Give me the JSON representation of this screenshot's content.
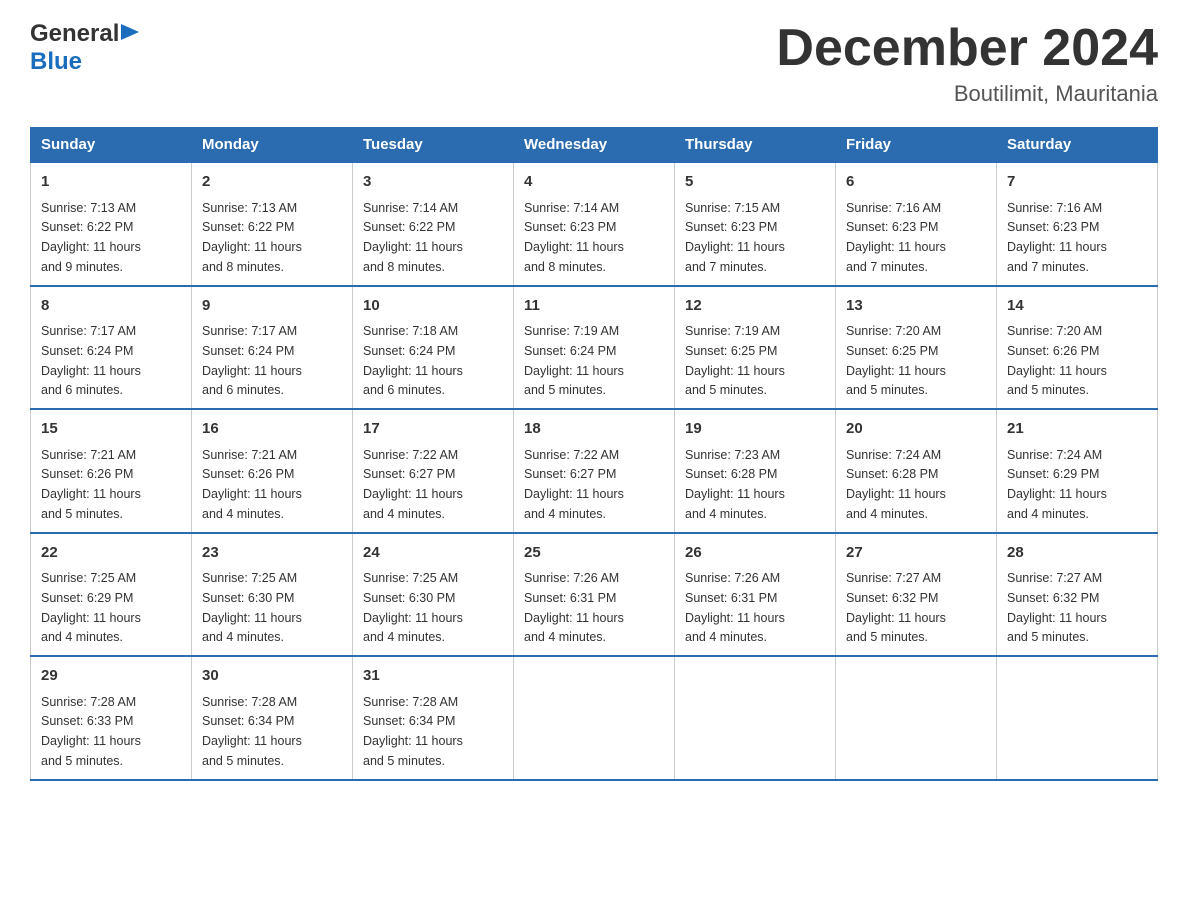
{
  "header": {
    "logo_general": "General",
    "logo_blue": "Blue",
    "month_title": "December 2024",
    "location": "Boutilimit, Mauritania"
  },
  "days_of_week": [
    "Sunday",
    "Monday",
    "Tuesday",
    "Wednesday",
    "Thursday",
    "Friday",
    "Saturday"
  ],
  "weeks": [
    [
      {
        "day": "1",
        "sunrise": "7:13 AM",
        "sunset": "6:22 PM",
        "daylight": "11 hours and 9 minutes."
      },
      {
        "day": "2",
        "sunrise": "7:13 AM",
        "sunset": "6:22 PM",
        "daylight": "11 hours and 8 minutes."
      },
      {
        "day": "3",
        "sunrise": "7:14 AM",
        "sunset": "6:22 PM",
        "daylight": "11 hours and 8 minutes."
      },
      {
        "day": "4",
        "sunrise": "7:14 AM",
        "sunset": "6:23 PM",
        "daylight": "11 hours and 8 minutes."
      },
      {
        "day": "5",
        "sunrise": "7:15 AM",
        "sunset": "6:23 PM",
        "daylight": "11 hours and 7 minutes."
      },
      {
        "day": "6",
        "sunrise": "7:16 AM",
        "sunset": "6:23 PM",
        "daylight": "11 hours and 7 minutes."
      },
      {
        "day": "7",
        "sunrise": "7:16 AM",
        "sunset": "6:23 PM",
        "daylight": "11 hours and 7 minutes."
      }
    ],
    [
      {
        "day": "8",
        "sunrise": "7:17 AM",
        "sunset": "6:24 PM",
        "daylight": "11 hours and 6 minutes."
      },
      {
        "day": "9",
        "sunrise": "7:17 AM",
        "sunset": "6:24 PM",
        "daylight": "11 hours and 6 minutes."
      },
      {
        "day": "10",
        "sunrise": "7:18 AM",
        "sunset": "6:24 PM",
        "daylight": "11 hours and 6 minutes."
      },
      {
        "day": "11",
        "sunrise": "7:19 AM",
        "sunset": "6:24 PM",
        "daylight": "11 hours and 5 minutes."
      },
      {
        "day": "12",
        "sunrise": "7:19 AM",
        "sunset": "6:25 PM",
        "daylight": "11 hours and 5 minutes."
      },
      {
        "day": "13",
        "sunrise": "7:20 AM",
        "sunset": "6:25 PM",
        "daylight": "11 hours and 5 minutes."
      },
      {
        "day": "14",
        "sunrise": "7:20 AM",
        "sunset": "6:26 PM",
        "daylight": "11 hours and 5 minutes."
      }
    ],
    [
      {
        "day": "15",
        "sunrise": "7:21 AM",
        "sunset": "6:26 PM",
        "daylight": "11 hours and 5 minutes."
      },
      {
        "day": "16",
        "sunrise": "7:21 AM",
        "sunset": "6:26 PM",
        "daylight": "11 hours and 4 minutes."
      },
      {
        "day": "17",
        "sunrise": "7:22 AM",
        "sunset": "6:27 PM",
        "daylight": "11 hours and 4 minutes."
      },
      {
        "day": "18",
        "sunrise": "7:22 AM",
        "sunset": "6:27 PM",
        "daylight": "11 hours and 4 minutes."
      },
      {
        "day": "19",
        "sunrise": "7:23 AM",
        "sunset": "6:28 PM",
        "daylight": "11 hours and 4 minutes."
      },
      {
        "day": "20",
        "sunrise": "7:24 AM",
        "sunset": "6:28 PM",
        "daylight": "11 hours and 4 minutes."
      },
      {
        "day": "21",
        "sunrise": "7:24 AM",
        "sunset": "6:29 PM",
        "daylight": "11 hours and 4 minutes."
      }
    ],
    [
      {
        "day": "22",
        "sunrise": "7:25 AM",
        "sunset": "6:29 PM",
        "daylight": "11 hours and 4 minutes."
      },
      {
        "day": "23",
        "sunrise": "7:25 AM",
        "sunset": "6:30 PM",
        "daylight": "11 hours and 4 minutes."
      },
      {
        "day": "24",
        "sunrise": "7:25 AM",
        "sunset": "6:30 PM",
        "daylight": "11 hours and 4 minutes."
      },
      {
        "day": "25",
        "sunrise": "7:26 AM",
        "sunset": "6:31 PM",
        "daylight": "11 hours and 4 minutes."
      },
      {
        "day": "26",
        "sunrise": "7:26 AM",
        "sunset": "6:31 PM",
        "daylight": "11 hours and 4 minutes."
      },
      {
        "day": "27",
        "sunrise": "7:27 AM",
        "sunset": "6:32 PM",
        "daylight": "11 hours and 5 minutes."
      },
      {
        "day": "28",
        "sunrise": "7:27 AM",
        "sunset": "6:32 PM",
        "daylight": "11 hours and 5 minutes."
      }
    ],
    [
      {
        "day": "29",
        "sunrise": "7:28 AM",
        "sunset": "6:33 PM",
        "daylight": "11 hours and 5 minutes."
      },
      {
        "day": "30",
        "sunrise": "7:28 AM",
        "sunset": "6:34 PM",
        "daylight": "11 hours and 5 minutes."
      },
      {
        "day": "31",
        "sunrise": "7:28 AM",
        "sunset": "6:34 PM",
        "daylight": "11 hours and 5 minutes."
      },
      null,
      null,
      null,
      null
    ]
  ],
  "labels": {
    "sunrise": "Sunrise:",
    "sunset": "Sunset:",
    "daylight": "Daylight:"
  }
}
